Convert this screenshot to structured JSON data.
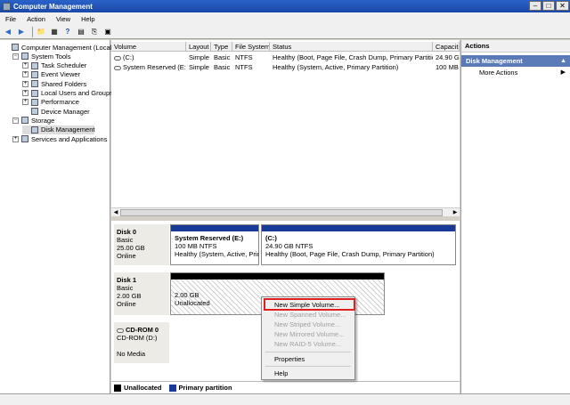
{
  "window": {
    "title": "Computer Management",
    "minimize": "–",
    "maximize": "□",
    "close": "✕"
  },
  "menu": [
    "File",
    "Action",
    "View",
    "Help"
  ],
  "toolbar": [
    "◀",
    "▶",
    "📁",
    "▦",
    "?",
    "▤",
    "⎘",
    "▣"
  ],
  "tree": [
    {
      "label": "Computer Management (Local)",
      "indent": 0,
      "exp": "",
      "icon": "computer-icon"
    },
    {
      "label": "System Tools",
      "indent": 1,
      "exp": "−",
      "icon": "tools-icon"
    },
    {
      "label": "Task Scheduler",
      "indent": 2,
      "exp": "+",
      "icon": "scheduler-icon"
    },
    {
      "label": "Event Viewer",
      "indent": 2,
      "exp": "+",
      "icon": "event-viewer-icon"
    },
    {
      "label": "Shared Folders",
      "indent": 2,
      "exp": "+",
      "icon": "shared-folder-icon"
    },
    {
      "label": "Local Users and Groups",
      "indent": 2,
      "exp": "+",
      "icon": "users-icon"
    },
    {
      "label": "Performance",
      "indent": 2,
      "exp": "+",
      "icon": "performance-icon"
    },
    {
      "label": "Device Manager",
      "indent": 2,
      "exp": "",
      "icon": "device-manager-icon"
    },
    {
      "label": "Storage",
      "indent": 1,
      "exp": "−",
      "icon": "storage-icon"
    },
    {
      "label": "Disk Management",
      "indent": 2,
      "exp": "",
      "icon": "disk-management-icon",
      "selected": true
    },
    {
      "label": "Services and Applications",
      "indent": 1,
      "exp": "+",
      "icon": "services-icon"
    }
  ],
  "volumes": {
    "columns": [
      "Volume",
      "Layout",
      "Type",
      "File System",
      "Status",
      "Capacit"
    ],
    "rows": [
      [
        "(C:)",
        "Simple",
        "Basic",
        "NTFS",
        "Healthy (Boot, Page File, Crash Dump, Primary Partition)",
        "24.90 G"
      ],
      [
        "System Reserved (E:)",
        "Simple",
        "Basic",
        "NTFS",
        "Healthy (System, Active, Primary Partition)",
        "100 MB"
      ]
    ]
  },
  "disks": [
    {
      "name": "Disk 0",
      "type": "Basic",
      "size": "25.00 GB",
      "state": "Online"
    },
    {
      "name": "Disk 1",
      "type": "Basic",
      "size": "2.00 GB",
      "state": "Online"
    },
    {
      "name": "CD-ROM 0",
      "type": "CD-ROM (D:)",
      "size": "",
      "state": "No Media"
    }
  ],
  "partitions": {
    "sysres": {
      "name": "System Reserved  (E:)",
      "size": "100 MB NTFS",
      "status": "Healthy (System, Active, Prim"
    },
    "c": {
      "name": "(C:)",
      "size": "24.90 GB NTFS",
      "status": "Healthy (Boot, Page File, Crash Dump, Primary Partition)"
    },
    "unalloc": {
      "size": "2.00 GB",
      "status": "Unallocated"
    }
  },
  "legend": {
    "unallocated": "Unallocated",
    "primary": "Primary partition"
  },
  "actions": {
    "header": "Actions",
    "section": "Disk Management",
    "more": "More Actions"
  },
  "context_menu": [
    {
      "label": "New Simple Volume...",
      "enabled": true
    },
    {
      "label": "New Spanned Volume...",
      "enabled": false
    },
    {
      "label": "New Striped Volume...",
      "enabled": false
    },
    {
      "label": "New Mirrored Volume...",
      "enabled": false
    },
    {
      "label": "New RAID-5 Volume...",
      "enabled": false
    },
    {
      "label": "Properties",
      "enabled": true
    },
    {
      "label": "Help",
      "enabled": true
    }
  ],
  "colors": {
    "title": "#1a48a8",
    "primary": "#1a3a98",
    "unallocated": "#000000",
    "highlight": "#e02020"
  }
}
